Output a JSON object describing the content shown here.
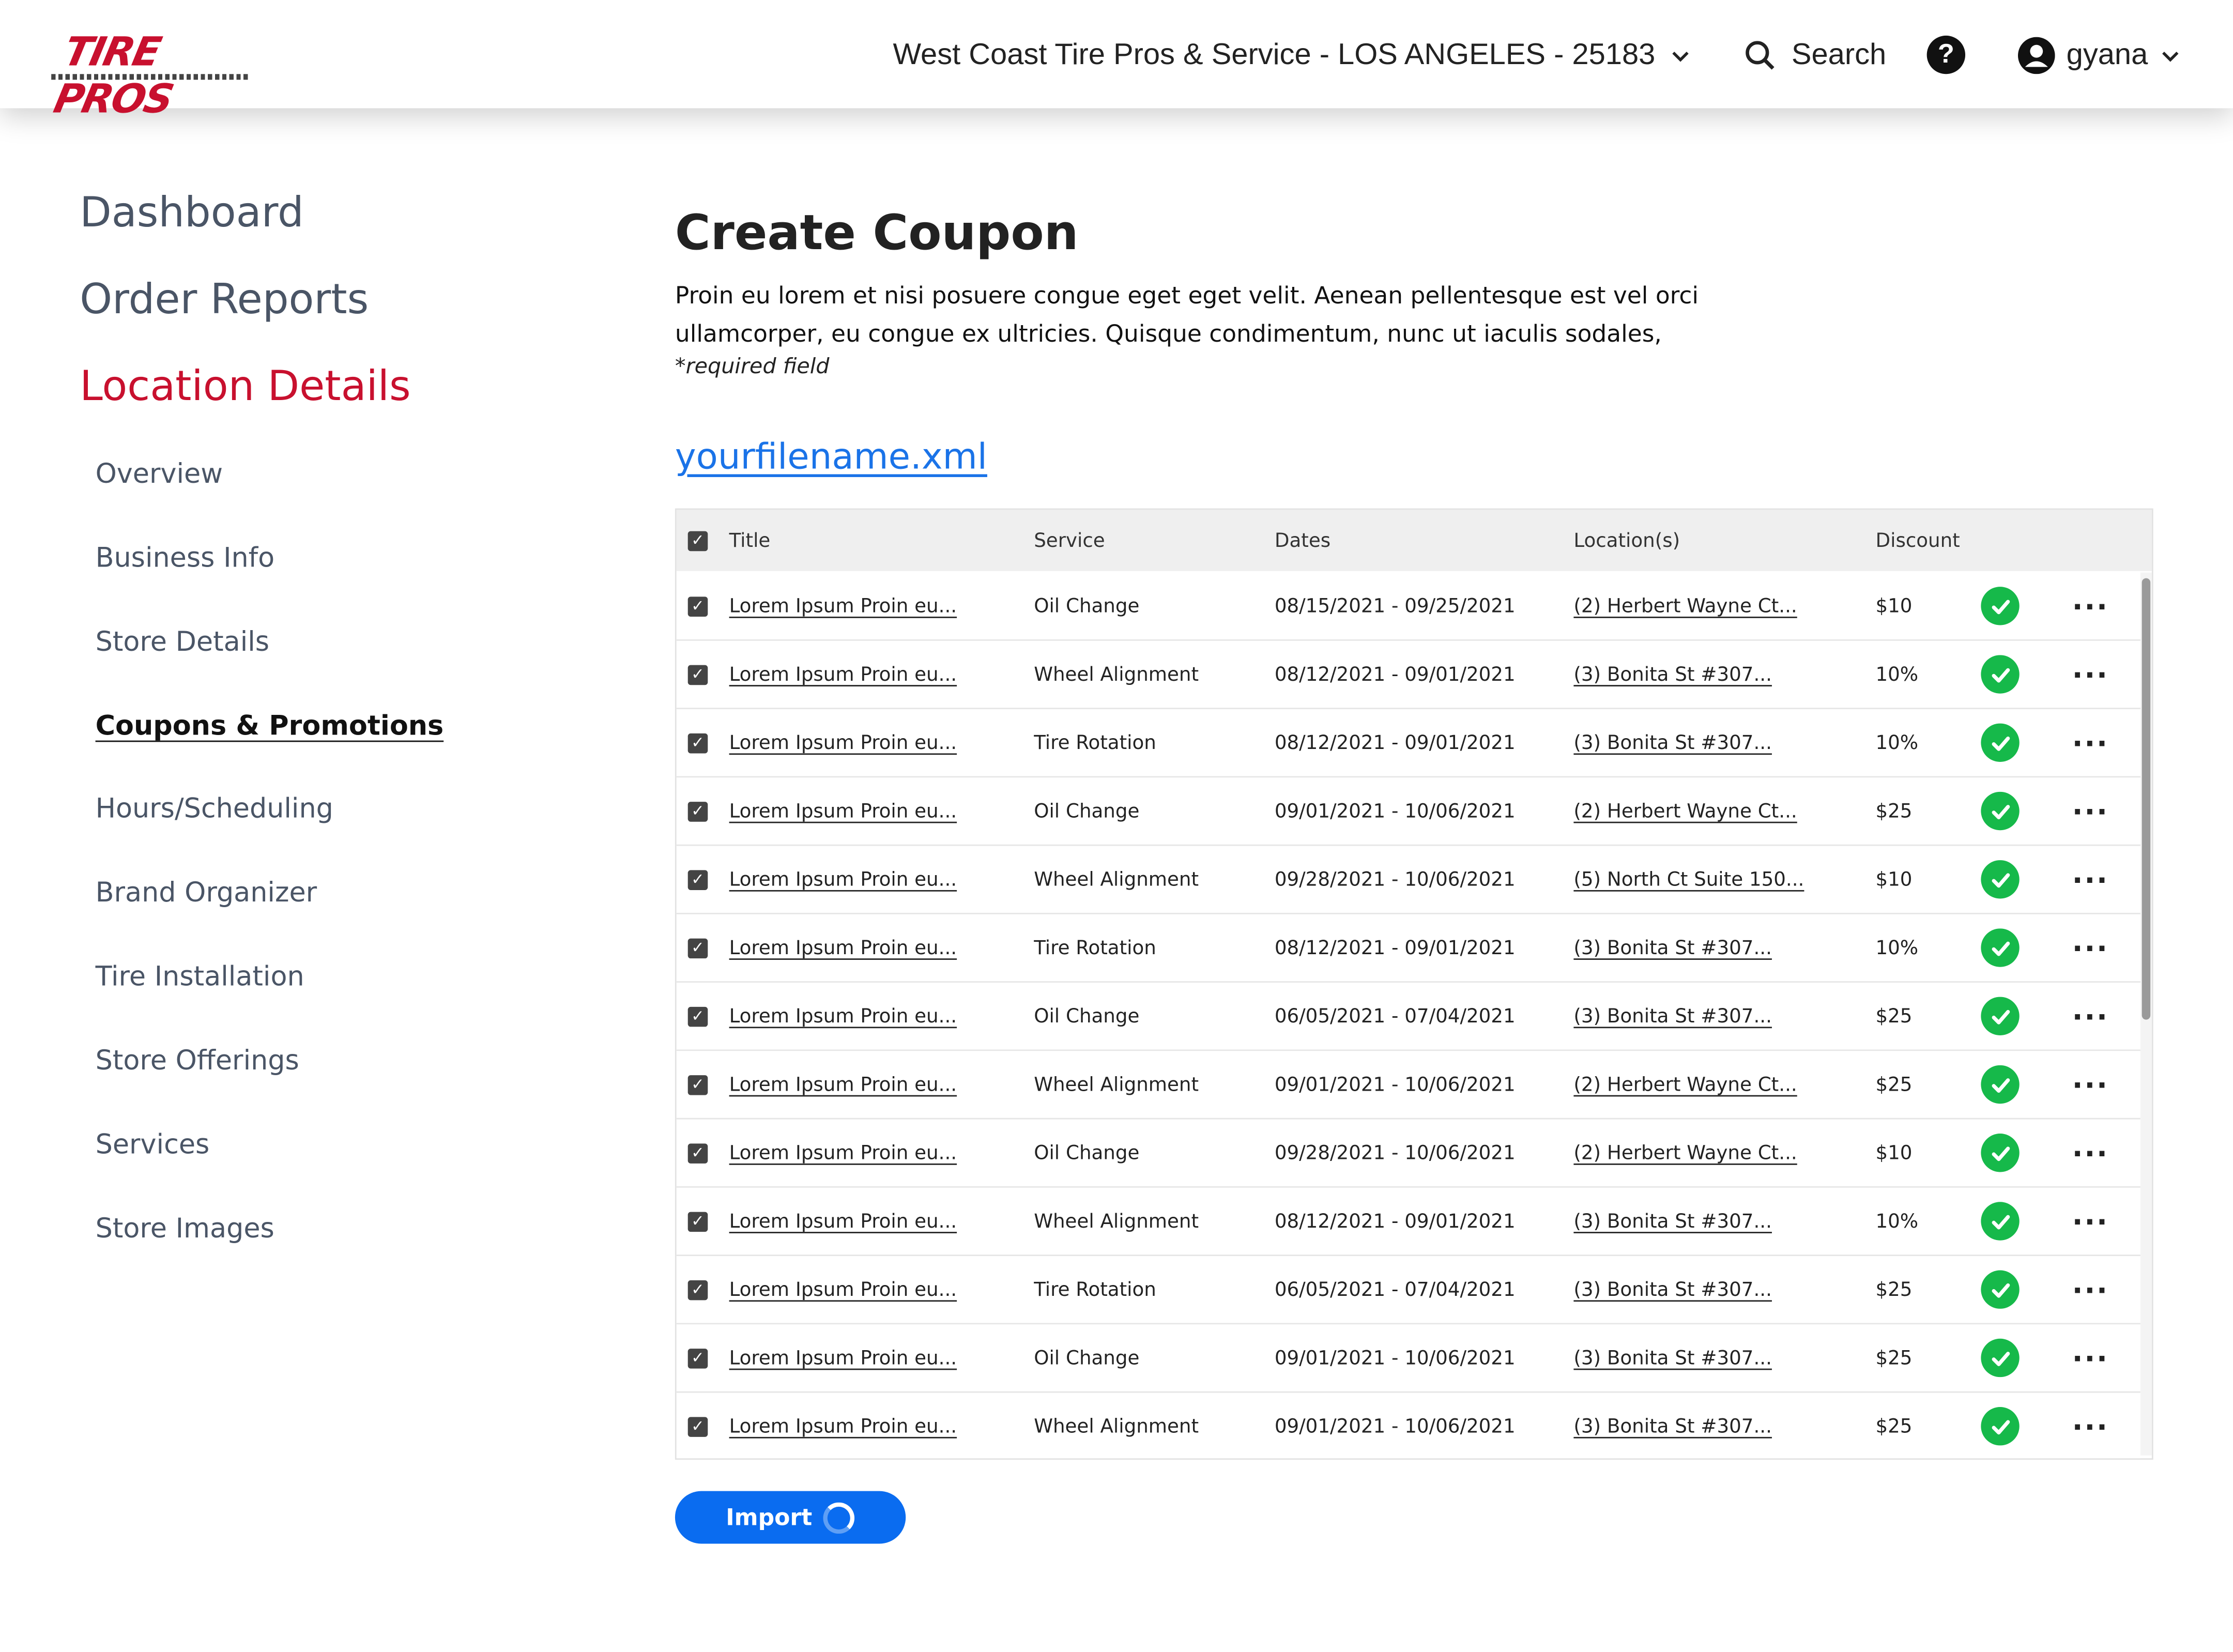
{
  "header": {
    "logo_text": "TIRE PROS",
    "location_label": "West Coast Tire Pros & Service - LOS ANGELES - 25183",
    "search_label": "Search",
    "user_name": "gyana"
  },
  "sidebar": {
    "top_items": [
      {
        "label": "Dashboard"
      },
      {
        "label": "Order Reports"
      },
      {
        "label": "Location Details"
      }
    ],
    "sub_items": [
      {
        "label": "Overview"
      },
      {
        "label": "Business Info"
      },
      {
        "label": "Store Details"
      },
      {
        "label": "Coupons & Promotions"
      },
      {
        "label": "Hours/Scheduling"
      },
      {
        "label": "Brand Organizer"
      },
      {
        "label": "Tire Installation"
      },
      {
        "label": "Store Offerings"
      },
      {
        "label": "Services"
      },
      {
        "label": "Store Images"
      }
    ]
  },
  "main": {
    "title": "Create Coupon",
    "description": "Proin eu lorem et nisi posuere congue eget eget velit. Aenean pellentesque est vel orci ullamcorper, eu congue ex ultricies. Quisque condimentum, nunc ut iaculis sodales,",
    "required_note": "*required field",
    "file_link": "yourfilename.xml",
    "import_label": "Import"
  },
  "table": {
    "columns": [
      "Title",
      "Service",
      "Dates",
      "Location(s)",
      "Discount"
    ],
    "rows": [
      {
        "title": "Lorem Ipsum Proin eu...",
        "service": "Oil Change",
        "dates": "08/15/2021 - 09/25/2021",
        "location": "(2) Herbert Wayne Ct...",
        "discount": "$10"
      },
      {
        "title": "Lorem Ipsum Proin eu...",
        "service": "Wheel Alignment",
        "dates": "08/12/2021 - 09/01/2021",
        "location": "(3) Bonita St #307...",
        "discount": "10%"
      },
      {
        "title": "Lorem Ipsum Proin eu...",
        "service": "Tire Rotation",
        "dates": "08/12/2021 - 09/01/2021",
        "location": "(3) Bonita St #307...",
        "discount": "10%"
      },
      {
        "title": "Lorem Ipsum Proin eu...",
        "service": "Oil Change",
        "dates": "09/01/2021 - 10/06/2021",
        "location": "(2) Herbert Wayne Ct...",
        "discount": "$25"
      },
      {
        "title": "Lorem Ipsum Proin eu...",
        "service": "Wheel Alignment",
        "dates": "09/28/2021 - 10/06/2021",
        "location": "(5) North Ct Suite 150...",
        "discount": "$10"
      },
      {
        "title": "Lorem Ipsum Proin eu...",
        "service": "Tire Rotation",
        "dates": "08/12/2021 - 09/01/2021",
        "location": "(3) Bonita St #307...",
        "discount": "10%"
      },
      {
        "title": "Lorem Ipsum Proin eu...",
        "service": "Oil Change",
        "dates": "06/05/2021 - 07/04/2021",
        "location": "(3) Bonita St #307...",
        "discount": "$25"
      },
      {
        "title": "Lorem Ipsum Proin eu...",
        "service": "Wheel Alignment",
        "dates": "09/01/2021 - 10/06/2021",
        "location": "(2) Herbert Wayne Ct...",
        "discount": "$25"
      },
      {
        "title": "Lorem Ipsum Proin eu...",
        "service": "Oil Change",
        "dates": "09/28/2021 - 10/06/2021",
        "location": "(2) Herbert Wayne Ct...",
        "discount": "$10"
      },
      {
        "title": "Lorem Ipsum Proin eu...",
        "service": "Wheel Alignment",
        "dates": "08/12/2021 - 09/01/2021",
        "location": "(3) Bonita St #307...",
        "discount": "10%"
      },
      {
        "title": "Lorem Ipsum Proin eu...",
        "service": "Tire Rotation",
        "dates": "06/05/2021 - 07/04/2021",
        "location": "(3) Bonita St #307...",
        "discount": "$25"
      },
      {
        "title": "Lorem Ipsum Proin eu...",
        "service": "Oil Change",
        "dates": "09/01/2021 - 10/06/2021",
        "location": "(3) Bonita St #307...",
        "discount": "$25"
      },
      {
        "title": "Lorem Ipsum Proin eu...",
        "service": "Wheel Alignment",
        "dates": "09/01/2021 - 10/06/2021",
        "location": "(3) Bonita St #307...",
        "discount": "$25"
      }
    ]
  },
  "icons": {
    "location_dropdown": "chevron-down-icon",
    "search": "search-icon",
    "help": "help-icon",
    "user": "account-icon",
    "user_dropdown": "chevron-down-icon",
    "row_status": "check-circle-icon",
    "row_menu": "more-horizontal-icon",
    "checkbox": "checkbox-checked-icon",
    "loading": "spinner-icon"
  },
  "colors": {
    "brand_red": "#c8102e",
    "link_blue": "#1a73e8",
    "button_blue": "#0a6cf0",
    "success_green": "#16b94a"
  }
}
